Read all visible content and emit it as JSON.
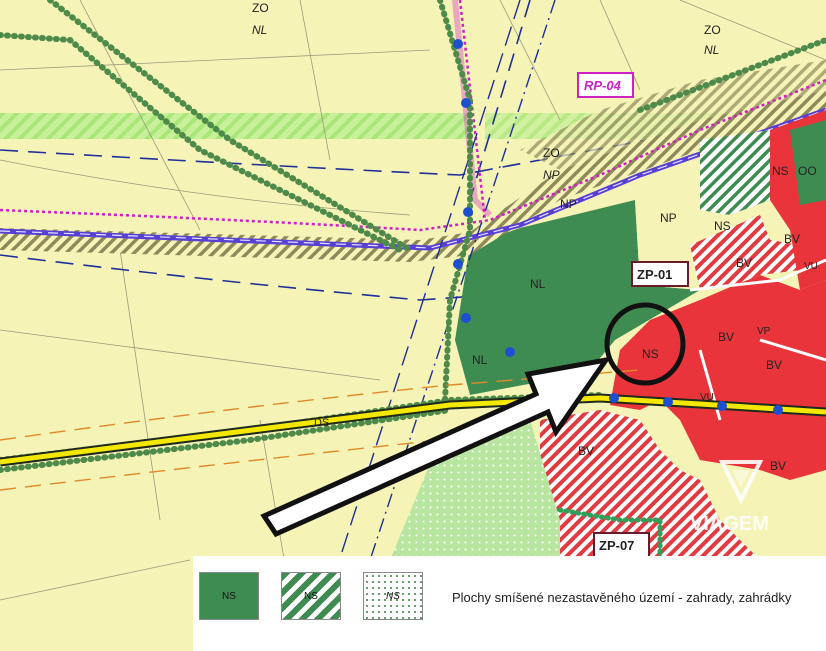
{
  "map": {
    "zones": {
      "zo_top": "ZO",
      "nl_top": "NL",
      "zo_right": "ZO",
      "nl_right": "NL",
      "zo_mid": "ZO",
      "np_mid": "NP",
      "np_strip": "NP",
      "np_green": "NP",
      "ns_right": "NS",
      "oo": "OO",
      "ns_hatch": "NS",
      "bv_1": "BV",
      "nl_center": "NL",
      "nl_lower": "NL",
      "ns_circle": "NS",
      "bv_2": "BV",
      "bv_3": "BV",
      "bv_4": "BV",
      "bv_5": "BV",
      "vu_1": "VU",
      "vu_2": "VU",
      "vp": "VP",
      "ds": "DS",
      "bv_6": "BV"
    },
    "plan_codes": {
      "rp04": "RP-04",
      "zp01": "ZP-01",
      "zp07": "ZP-07"
    },
    "watermark": "VIAGEM",
    "colors": {
      "meadow": "#f6f3b6",
      "forest": "#3f8c52",
      "built": "#e8343a",
      "road_yellow": "#f4e800",
      "rail": "#5a3fd6",
      "magenta": "#d020c8",
      "tree_green": "#4e8a4a"
    }
  },
  "legend": {
    "swatch_1": "NS",
    "swatch_2": "NS",
    "swatch_3": "NS",
    "description": "Plochy smíšené nezastavěného území - zahrady, zahrádky"
  }
}
